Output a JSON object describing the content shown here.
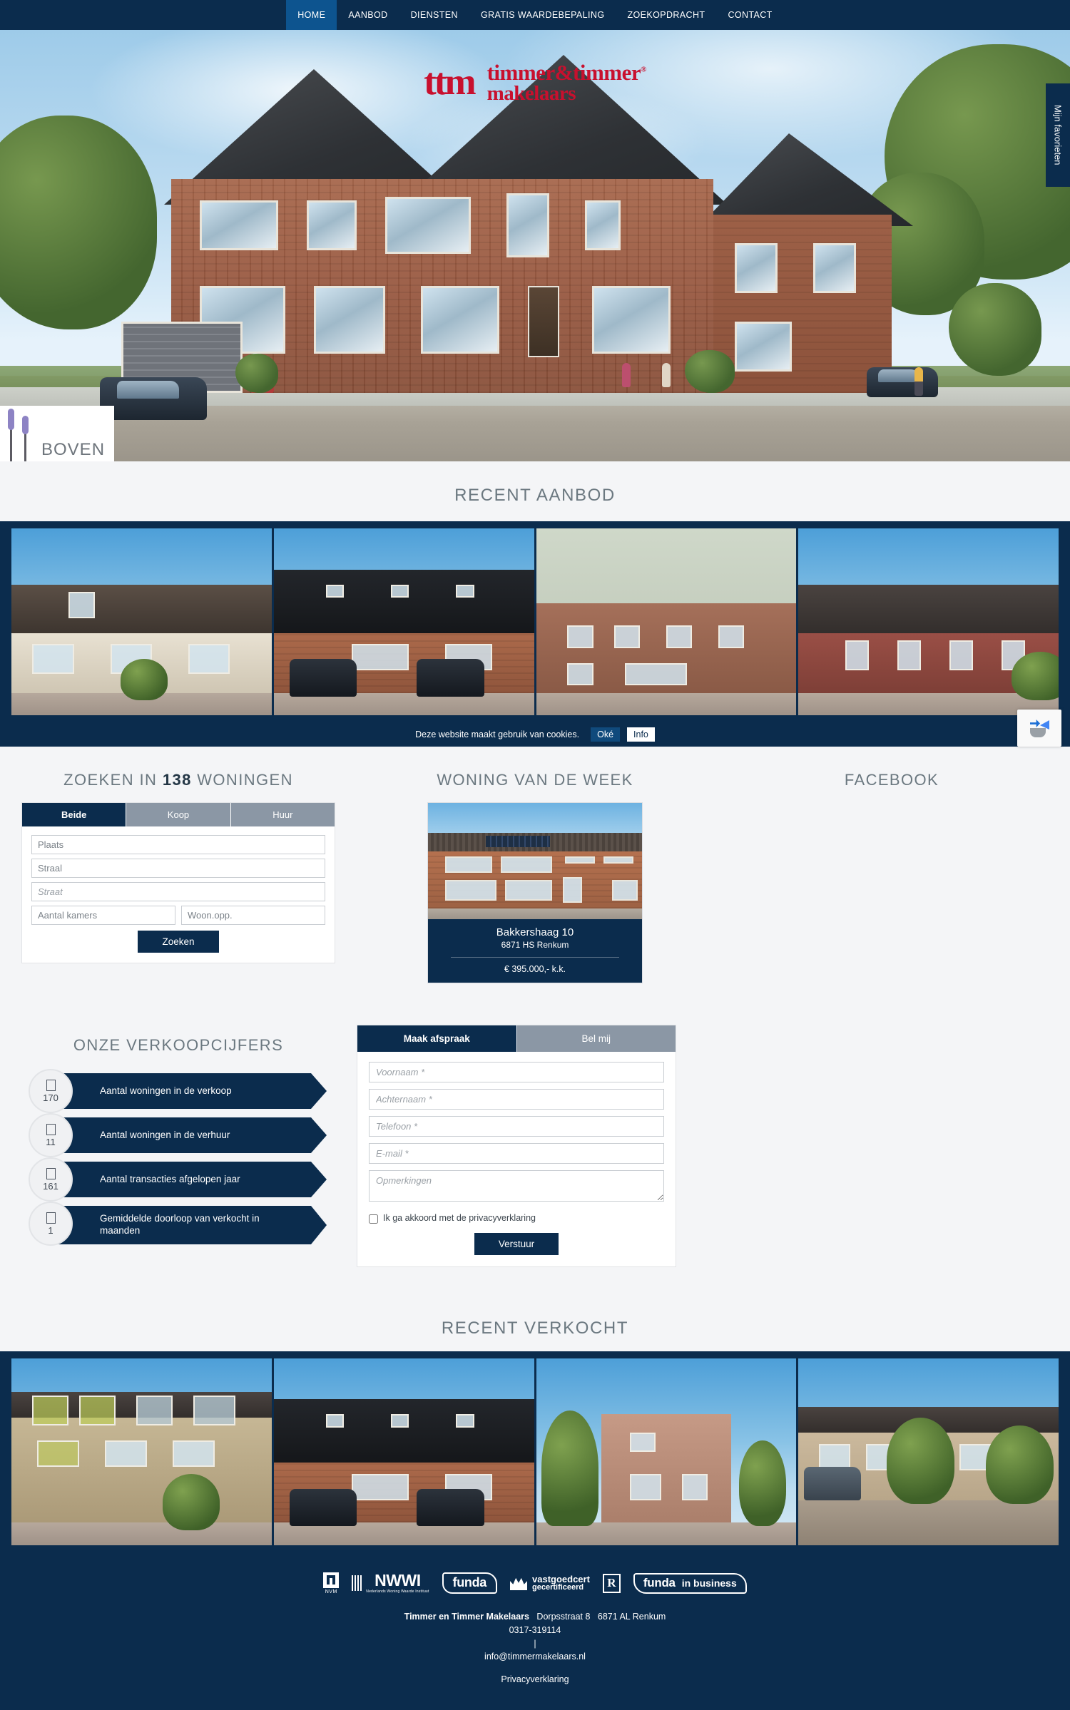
{
  "nav": {
    "items": [
      {
        "label": "HOME",
        "active": true
      },
      {
        "label": "AANBOD",
        "active": false
      },
      {
        "label": "DIENSTEN",
        "active": false
      },
      {
        "label": "GRATIS WAARDEBEPALING",
        "active": false
      },
      {
        "label": "ZOEKOPDRACHT",
        "active": false
      },
      {
        "label": "CONTACT",
        "active": false
      }
    ]
  },
  "hero": {
    "logo_mark": "ttm",
    "logo_line1": "timmer&timmer",
    "logo_reg": "®",
    "logo_line2": "makelaars",
    "favorites_tab": "Mijn favorieten",
    "promo_text": "BOVEN"
  },
  "recent_aanbod": {
    "heading": "RECENT AANBOD",
    "items": [
      {
        "alt": "Woning met witte puntgevel en zonnepanelen"
      },
      {
        "alt": "Twee-onder-een-kap met zwart dak en auto's"
      },
      {
        "alt": "Nieuwbouw appartementencomplex luchtfoto"
      },
      {
        "alt": "Rij nieuwbouwwoningen met verkeersbord"
      }
    ]
  },
  "cookies": {
    "text": "Deze website maakt gebruik van cookies.",
    "ok_label": "Oké",
    "info_label": "Info"
  },
  "search": {
    "heading_before": "ZOEKEN IN ",
    "heading_count": "138",
    "heading_after": " WONINGEN",
    "tabs": [
      {
        "label": "Beide",
        "active": true
      },
      {
        "label": "Koop",
        "active": false
      },
      {
        "label": "Huur",
        "active": false
      }
    ],
    "plaats_placeholder": "Plaats",
    "straal_placeholder": "Straal",
    "straat_placeholder": "Straat",
    "kamers_placeholder": "Aantal kamers",
    "oppervlakte_placeholder": "Woon.opp.",
    "submit_label": "Zoeken"
  },
  "woning_week": {
    "heading": "WONING VAN DE WEEK",
    "address": "Bakkershaag 10",
    "zip_city": "6871 HS Renkum",
    "price": "€ 395.000,- k.k."
  },
  "facebook": {
    "heading": "FACEBOOK"
  },
  "verkoopcijfers": {
    "heading": "ONZE VERKOOPCIJFERS",
    "items": [
      {
        "value": "170",
        "label": "Aantal woningen in de verkoop"
      },
      {
        "value": "11",
        "label": "Aantal woningen in de verhuur"
      },
      {
        "value": "161",
        "label": "Aantal transacties afgelopen jaar"
      },
      {
        "value": "1",
        "label": "Gemiddelde doorloop van verkocht in maanden"
      }
    ]
  },
  "contact_form": {
    "tabs": [
      {
        "label": "Maak afspraak",
        "active": true
      },
      {
        "label": "Bel mij",
        "active": false
      }
    ],
    "voornaam_placeholder": "Voornaam *",
    "achternaam_placeholder": "Achternaam *",
    "telefoon_placeholder": "Telefoon *",
    "email_placeholder": "E-mail *",
    "opmerkingen_placeholder": "Opmerkingen",
    "consent_label": "Ik ga akkoord met de privacyverklaring",
    "submit_label": "Verstuur"
  },
  "recent_verkocht": {
    "heading": "RECENT VERKOCHT",
    "items": [
      {
        "alt": "Woning met dakkapellen en fietsen"
      },
      {
        "alt": "Twee-onder-een-kap met zwart dak en auto's"
      },
      {
        "alt": "Vrijstaande woning met conifeer"
      },
      {
        "alt": "Rijtjeswoning met haag en auto"
      }
    ]
  },
  "footer": {
    "badges": [
      {
        "name": "NVM",
        "caption": "NVM"
      },
      {
        "name": "NWWI",
        "caption": "NWWI",
        "sub": "Nederlands Woning Waarde Instituut"
      },
      {
        "name": "funda",
        "caption": "funda"
      },
      {
        "name": "vastgoedcert",
        "line1": "vastgoedcert",
        "line2": "gecertificeerd"
      },
      {
        "name": "R-keurmerk",
        "caption": "R"
      },
      {
        "name": "funda in business",
        "line1": "funda",
        "line2": "in business"
      }
    ],
    "company": "Timmer en Timmer Makelaars",
    "street": "Dorpsstraat 8",
    "city": "6871 AL Renkum",
    "phone": "0317-319114",
    "separator": "|",
    "email": "info@timmermakelaars.nl",
    "privacy_link": "Privacyverklaring"
  },
  "colors": {
    "navy": "#0b2c4d",
    "nav_active": "#0d548f",
    "brand_red": "#c8102e",
    "tab_inactive": "#8b97a5",
    "page_bg": "#f4f5f7"
  }
}
